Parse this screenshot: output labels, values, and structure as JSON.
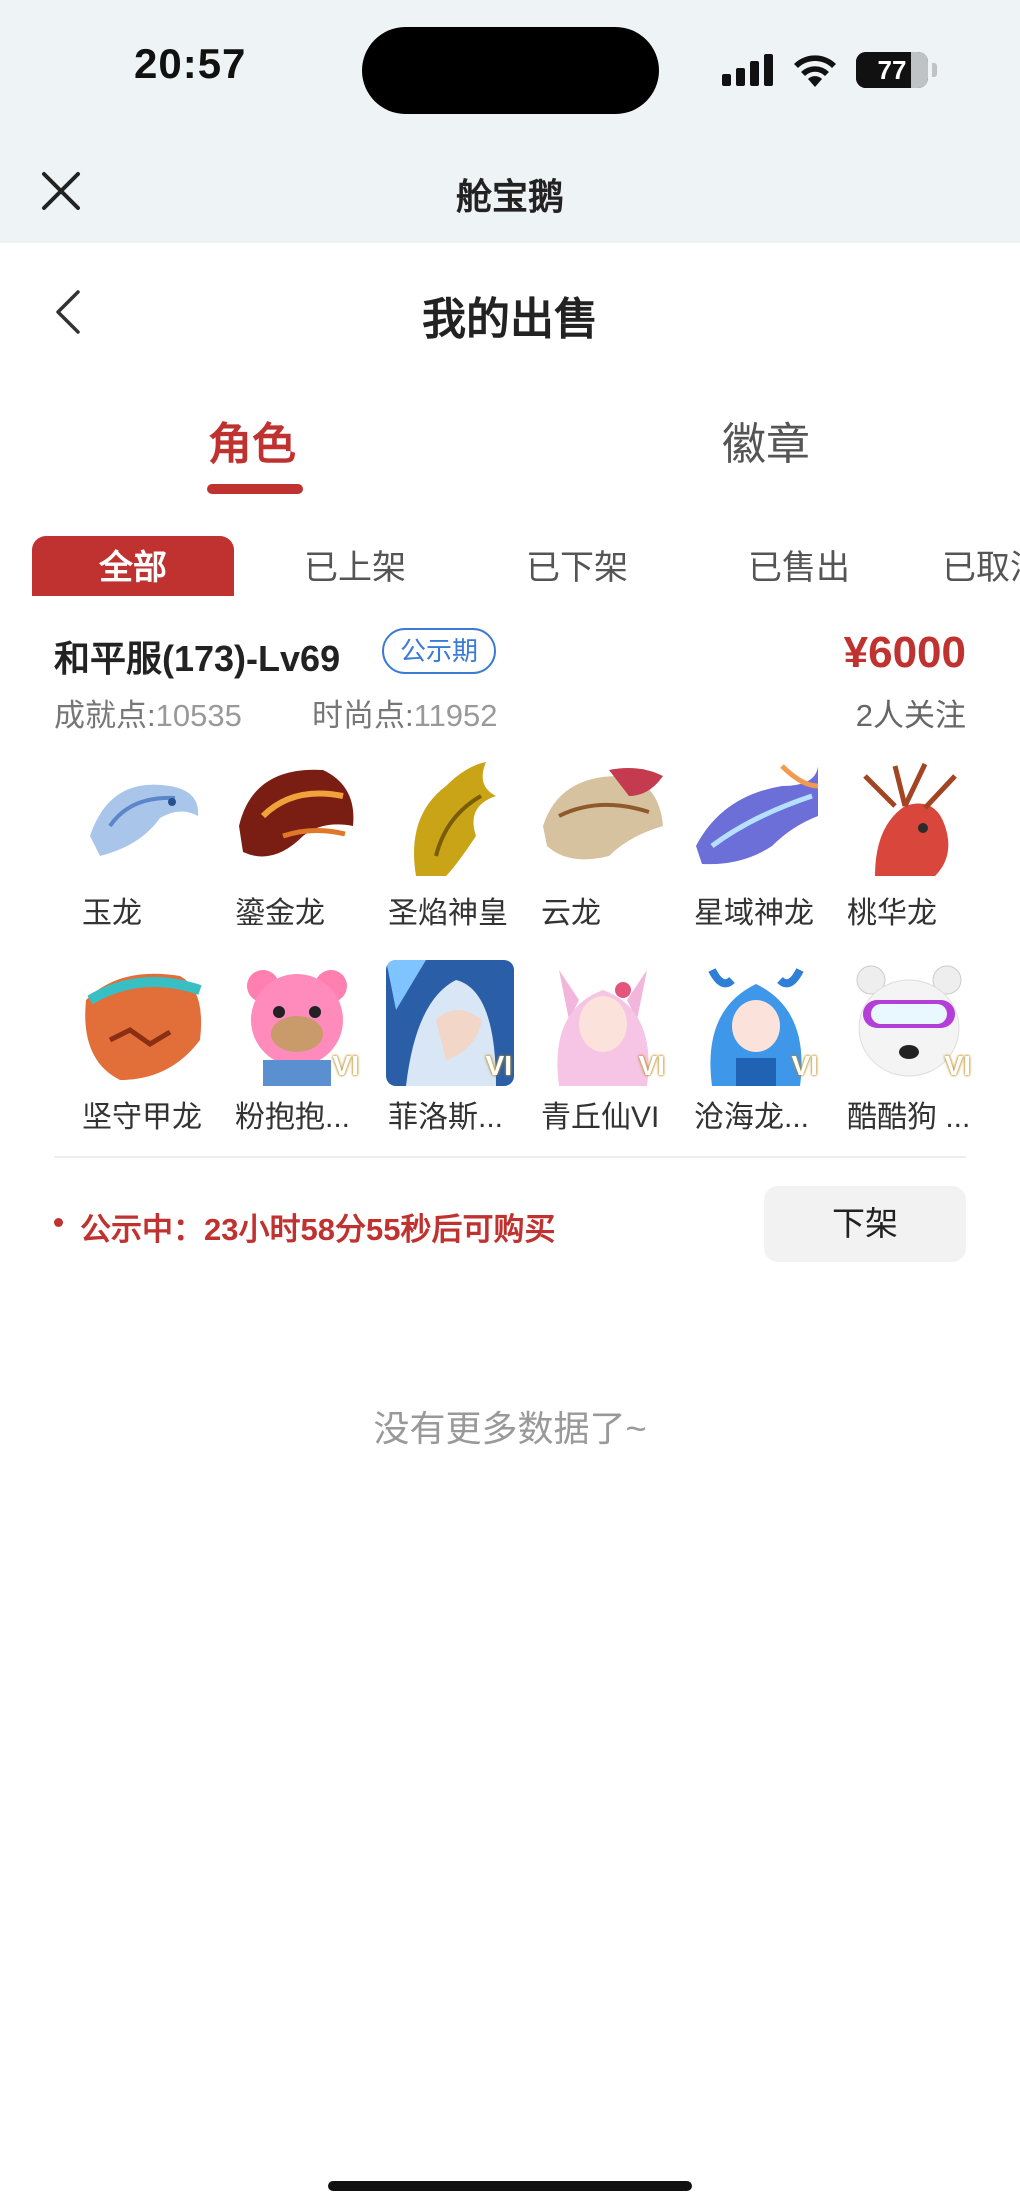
{
  "status_bar": {
    "time": "20:57",
    "battery": "77",
    "battery_level_percent": 77
  },
  "app_bar": {
    "title": "舱宝鹅",
    "close_icon": "close-icon"
  },
  "page": {
    "title": "我的出售",
    "back_icon": "chevron-left-icon"
  },
  "main_tabs": [
    {
      "label": "角色",
      "active": true
    },
    {
      "label": "徽章",
      "active": false
    }
  ],
  "filter_tabs": [
    {
      "label": "全部",
      "active": true
    },
    {
      "label": "已上架",
      "active": false
    },
    {
      "label": "已下架",
      "active": false
    },
    {
      "label": "已售出",
      "active": false
    },
    {
      "label": "已取消",
      "active": false
    }
  ],
  "listing": {
    "title": "和平服(173)-Lv69",
    "badge": "公示期",
    "price": "¥6000",
    "achievement_label": "成就点:",
    "achievement_value": "10535",
    "fashion_label": "时尚点:",
    "fashion_value": "11952",
    "followers": "2人关注",
    "items": [
      {
        "name": "玉龙",
        "image": "white-dragon"
      },
      {
        "name": "鎏金龙",
        "image": "red-gold-dragon"
      },
      {
        "name": "圣焰神皇",
        "image": "golden-dragon"
      },
      {
        "name": "云龙",
        "image": "cloud-dragon"
      },
      {
        "name": "星域神龙",
        "image": "blue-purple-dragon"
      },
      {
        "name": "桃华龙",
        "image": "peach-dragon"
      },
      {
        "name": "坚守甲龙",
        "image": "armored-dragon"
      },
      {
        "name": "粉抱抱...",
        "image": "pink-bear",
        "badge": "VI"
      },
      {
        "name": "菲洛斯...",
        "image": "silver-hair-character",
        "badge": "VI"
      },
      {
        "name": "青丘仙VI",
        "image": "fox-fairy",
        "badge": "VI"
      },
      {
        "name": "沧海龙...",
        "image": "blue-dragon-girl",
        "badge": "VI"
      },
      {
        "name": "酷酷狗 ...",
        "image": "white-dog-goggles",
        "badge": "VI"
      }
    ],
    "notice": "公示中：23小时58分55秒后可购买",
    "action_label": "下架"
  },
  "footer_text": "没有更多数据了~",
  "colors": {
    "accent": "#c0322f",
    "badge_blue": "#3a7bd5",
    "top_bg": "#eef3f6"
  }
}
